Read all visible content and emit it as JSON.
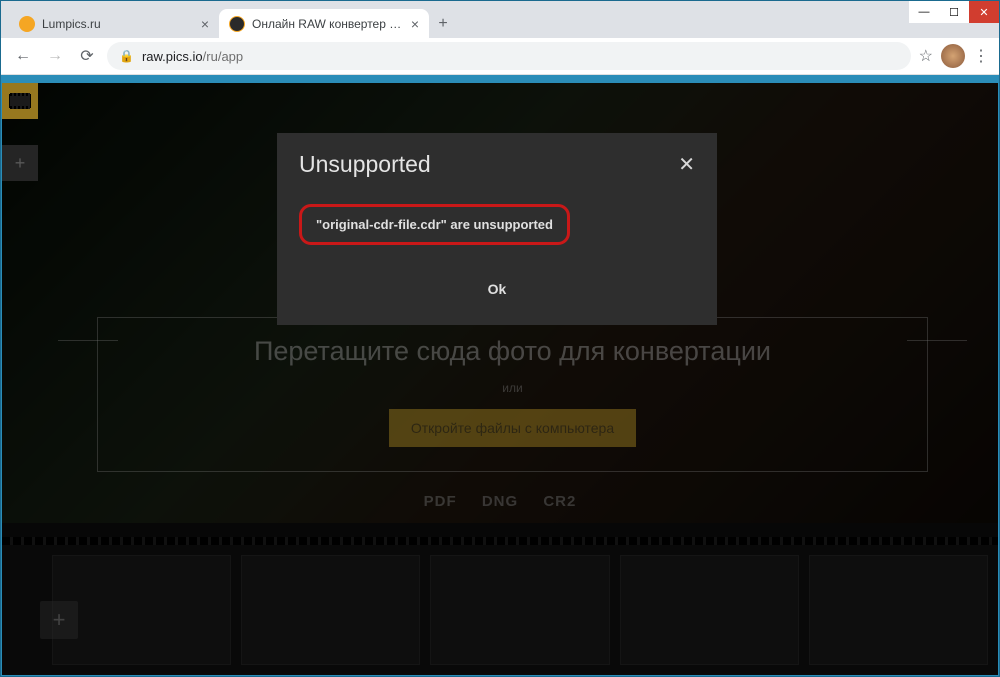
{
  "window": {
    "minimize": "—",
    "maximize": "☐",
    "close": "✕"
  },
  "tabs": {
    "items": [
      {
        "title": "Lumpics.ru",
        "favicon_color": "#f5a623"
      },
      {
        "title": "Онлайн RAW конвертер | Обра",
        "favicon_color": "#2a2a2a"
      }
    ],
    "new_tab": "+",
    "close_glyph": "×"
  },
  "address": {
    "back": "←",
    "forward": "→",
    "reload": "⟳",
    "lock": "🔒",
    "domain": "raw.pics.io",
    "path": "/ru/app",
    "star": "☆",
    "menu": "⋮"
  },
  "toolbar": {
    "plus": "+"
  },
  "dropzone": {
    "title": "Перетащите сюда фото для конвертации",
    "or": "или",
    "open_button": "Откройте файлы с компьютера"
  },
  "formats": {
    "f1": "PDF",
    "f2": "DNG",
    "f3": "CR2"
  },
  "thumbstrip": {
    "add": "+"
  },
  "modal": {
    "title": "Unsupported",
    "close": "✕",
    "message": "\"original-cdr-file.cdr\" are unsupported",
    "ok": "Ok"
  }
}
